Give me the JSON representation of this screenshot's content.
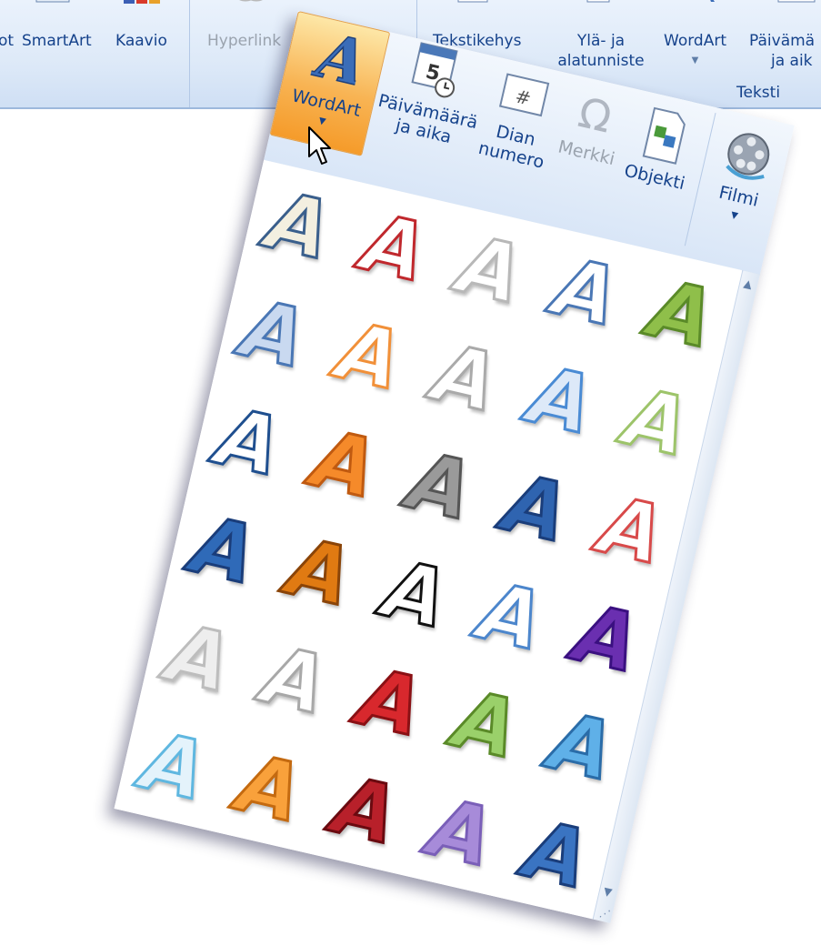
{
  "ribbon": {
    "buttons": [
      {
        "label": "ot",
        "icon": "picture-icon"
      },
      {
        "label": "SmartArt",
        "icon": "smartart-icon"
      },
      {
        "label": "Kaavio",
        "icon": "chart-icon"
      },
      {
        "label": "Hyperlink",
        "icon": "hyperlink-icon"
      },
      {
        "label": "Tekstikehys",
        "icon": "textbox-icon"
      },
      {
        "label": "Ylä- ja",
        "label2": "alatunniste",
        "icon": "header-footer-icon"
      },
      {
        "label": "WordArt",
        "icon": "wordart-icon"
      },
      {
        "label": "Päivämä",
        "label2": "ja aik",
        "icon": "date-time-icon"
      }
    ],
    "group_label": "Teksti"
  },
  "flyout": {
    "wordart_label": "WordArt",
    "date_label1": "Päivämäärä",
    "date_label2": "ja aika",
    "slide_num_label1": "Dian",
    "slide_num_label2": "numero",
    "symbol_label": "Merkki",
    "object_label": "Objekti",
    "movie_label": "Filmi",
    "gallery_glyph": "A",
    "styles": [
      {
        "fill": "#f3efe0",
        "stroke": "#3a5f8c"
      },
      {
        "fill": "#ffffff",
        "stroke": "#c0282d"
      },
      {
        "fill": "#ffffff",
        "stroke": "#b8b8b8"
      },
      {
        "fill": "#ffffff",
        "stroke": "#4a77b5"
      },
      {
        "fill": "#8fbf4a",
        "stroke": "#5a8a28"
      },
      {
        "fill": "#c9d9f0",
        "stroke": "#4a77b5"
      },
      {
        "fill": "#ffffff",
        "stroke": "#f19039"
      },
      {
        "fill": "#ffffff",
        "stroke": "#aaaaaa"
      },
      {
        "fill": "#dde9f8",
        "stroke": "#4a8bd4"
      },
      {
        "fill": "#ffffff",
        "stroke": "#9dc46a"
      },
      {
        "fill": "#ffffff",
        "stroke": "#1f4f8f"
      },
      {
        "fill": "#f58a2a",
        "stroke": "#c05a10"
      },
      {
        "fill": "#9a9a9a",
        "stroke": "#555555"
      },
      {
        "fill": "#2f64b0",
        "stroke": "#1a3d7a"
      },
      {
        "fill": "#ffffff",
        "stroke": "#d84a4a"
      },
      {
        "fill": "#2f6ab8",
        "stroke": "#1a3d7a"
      },
      {
        "fill": "#e07a12",
        "stroke": "#8a4408"
      },
      {
        "fill": "#ffffff",
        "stroke": "#111111"
      },
      {
        "fill": "#ffffff",
        "stroke": "#4c86cc"
      },
      {
        "fill": "#6a2fb0",
        "stroke": "#3a1080"
      },
      {
        "fill": "#eeeeee",
        "stroke": "#bdbdbd"
      },
      {
        "fill": "#ffffff",
        "stroke": "#a8a8a8"
      },
      {
        "fill": "#d8282d",
        "stroke": "#8a1014"
      },
      {
        "fill": "#9ad06a",
        "stroke": "#5a8a28"
      },
      {
        "fill": "#5fb0e8",
        "stroke": "#2a6ca8"
      },
      {
        "fill": "#e4f3fb",
        "stroke": "#5fb7e0"
      },
      {
        "fill": "#f9a13b",
        "stroke": "#c46a10"
      },
      {
        "fill": "#b8202a",
        "stroke": "#6a0a10"
      },
      {
        "fill": "#a78bd9",
        "stroke": "#7a5fb8"
      },
      {
        "fill": "#3a74c2",
        "stroke": "#1a3d7a"
      }
    ]
  }
}
